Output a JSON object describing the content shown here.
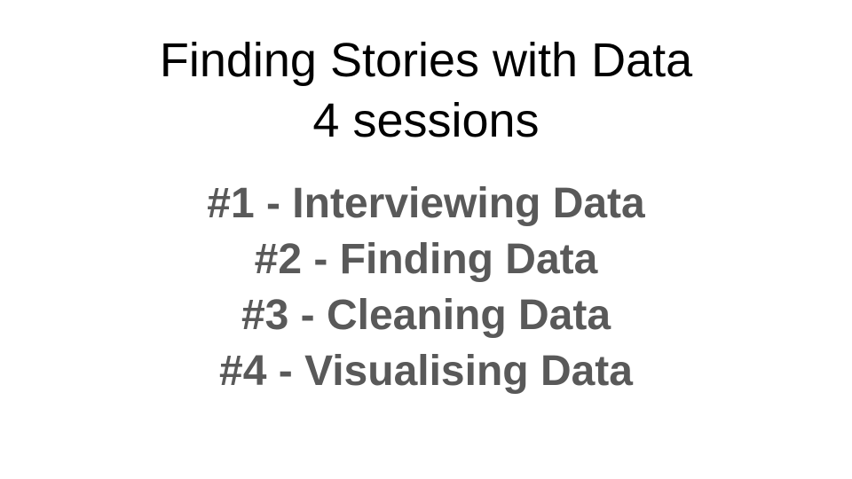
{
  "slide": {
    "title": "Finding Stories with Data",
    "subtitle": "4 sessions",
    "sessions": [
      "#1 - Interviewing Data",
      "#2 - Finding Data",
      "#3 - Cleaning Data",
      "#4 - Visualising Data"
    ]
  },
  "colors": {
    "title": "#000000",
    "sessions": "#595959",
    "background": "#ffffff"
  }
}
